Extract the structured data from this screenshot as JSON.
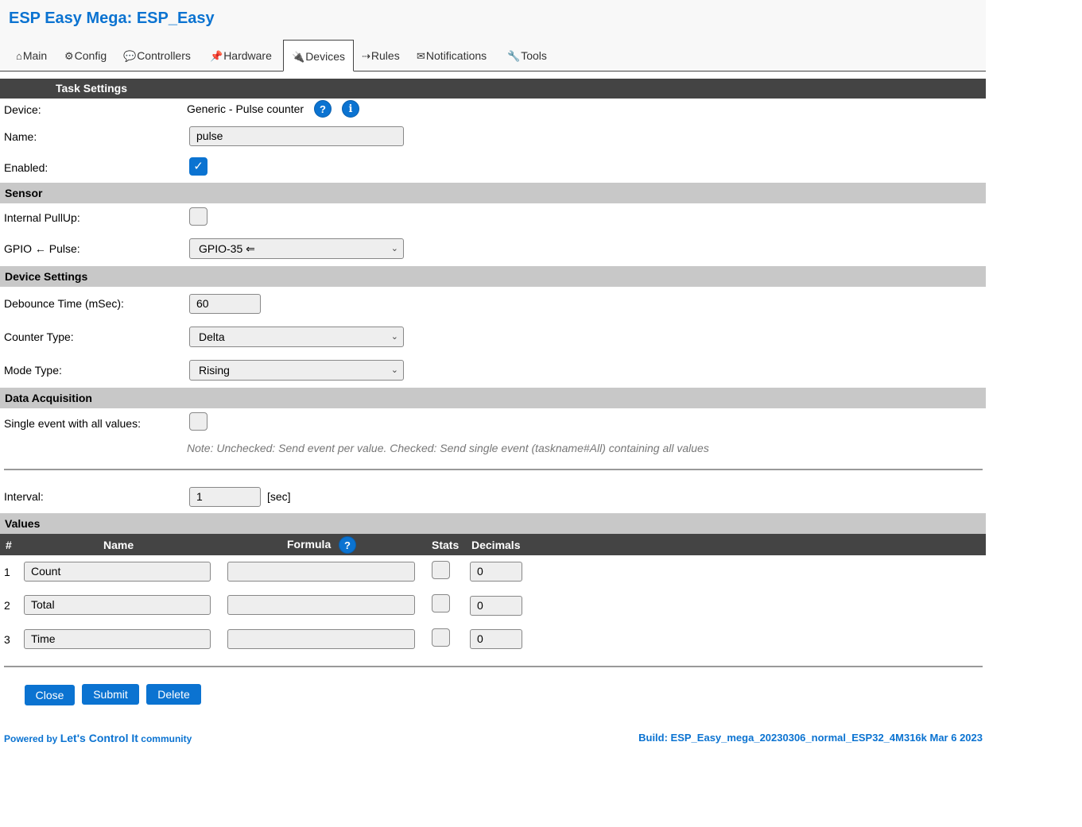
{
  "app_title": "ESP Easy Mega: ESP_Easy",
  "tabs": [
    {
      "icon": "⌂",
      "label": "Main"
    },
    {
      "icon": "⚙",
      "label": "Config"
    },
    {
      "icon": "💬",
      "label": "Controllers"
    },
    {
      "icon": "📌",
      "label": "Hardware"
    },
    {
      "icon": "🔌",
      "label": "Devices"
    },
    {
      "icon": "⇢",
      "label": "Rules"
    },
    {
      "icon": "✉",
      "label": "Notifications"
    },
    {
      "icon": "🔧",
      "label": "Tools"
    }
  ],
  "active_tab": "Devices",
  "task_settings": {
    "header": "Task Settings",
    "device_label": "Device:",
    "device_value": "Generic - Pulse counter",
    "help_icon": "?",
    "info_icon": "i",
    "name_label": "Name:",
    "name_value": "pulse",
    "enabled_label": "Enabled:",
    "enabled_checked": true
  },
  "sensor": {
    "header": "Sensor",
    "pullup_label": "Internal PullUp:",
    "gpio_label": "GPIO ← Pulse:",
    "gpio_value": "GPIO-35 ⇐"
  },
  "device_settings": {
    "header": "Device Settings",
    "debounce_label": "Debounce Time (mSec):",
    "debounce_value": "60",
    "counter_type_label": "Counter Type:",
    "counter_type_value": "Delta",
    "mode_type_label": "Mode Type:",
    "mode_type_value": "Rising"
  },
  "data_acquisition": {
    "header": "Data Acquisition",
    "single_event_label": "Single event with all values:",
    "note": "Note: Unchecked: Send event per value. Checked: Send single event (taskname#All) containing all values",
    "interval_label": "Interval:",
    "interval_value": "1",
    "interval_unit": "[sec]"
  },
  "values": {
    "header": "Values",
    "columns": {
      "num": "#",
      "name": "Name",
      "formula": "Formula",
      "stats": "Stats",
      "decimals": "Decimals"
    },
    "rows": [
      {
        "num": "1",
        "name": "Count",
        "formula": "",
        "decimals": "0"
      },
      {
        "num": "2",
        "name": "Total",
        "formula": "",
        "decimals": "0"
      },
      {
        "num": "3",
        "name": "Time",
        "formula": "",
        "decimals": "0"
      }
    ]
  },
  "buttons": {
    "close": "Close",
    "submit": "Submit",
    "delete": "Delete"
  },
  "footer": {
    "powered_prefix": "Powered by",
    "powered_link": "Let's Control It",
    "powered_suffix": "community",
    "build": "Build: ESP_Easy_mega_20230306_normal_ESP32_4M316k Mar 6 2023"
  },
  "colors": {
    "accent": "#0b73d1",
    "dark_bar": "#444444",
    "light_bar": "#c8c8c8"
  }
}
